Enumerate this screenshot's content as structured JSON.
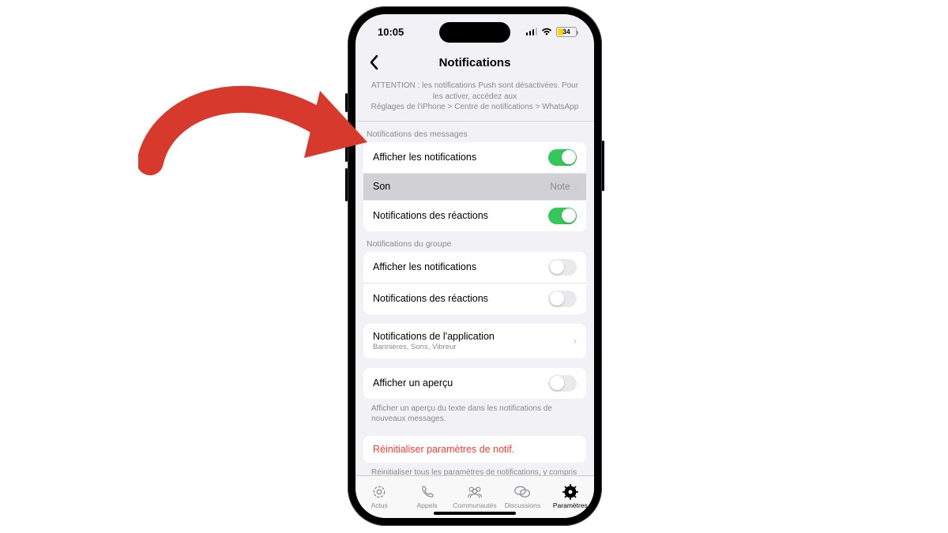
{
  "status": {
    "time": "10:05",
    "battery_pct": "34",
    "battery_fill_pct": 34
  },
  "header": {
    "title": "Notifications"
  },
  "warning": {
    "line1": "ATTENTION : les notifications Push sont désactivées. Pour les activer, accédez aux",
    "line2": "Réglages de l'iPhone > Centre de notifications > WhatsApp"
  },
  "sections": {
    "messages": {
      "title": "Notifications des messages",
      "show_label": "Afficher les notifications",
      "show_on": true,
      "sound_label": "Son",
      "sound_value": "Note",
      "reactions_label": "Notifications des réactions",
      "reactions_on": true
    },
    "group": {
      "title": "Notifications du groupe",
      "show_label": "Afficher les notifications",
      "show_on": false,
      "reactions_label": "Notifications des réactions",
      "reactions_on": false
    },
    "inapp": {
      "label": "Notifications de l'application",
      "sub": "Bannières, Sons, Vibreur"
    },
    "preview": {
      "label": "Afficher un aperçu",
      "on": false,
      "footer": "Afficher un aperçu du texte dans les notifications de nouveaux messages."
    },
    "reset": {
      "label": "Réinitialiser paramètres de notif.",
      "footer": "Réinitialiser tous les paramètres de notifications, y compris les notifications personnalisées pour vos discussions."
    }
  },
  "tabs": {
    "updates": "Actus",
    "calls": "Appels",
    "communities": "Communautés",
    "chats": "Discussions",
    "settings": "Paramètres"
  },
  "annotation": {
    "arrow_color": "#d7392c"
  }
}
